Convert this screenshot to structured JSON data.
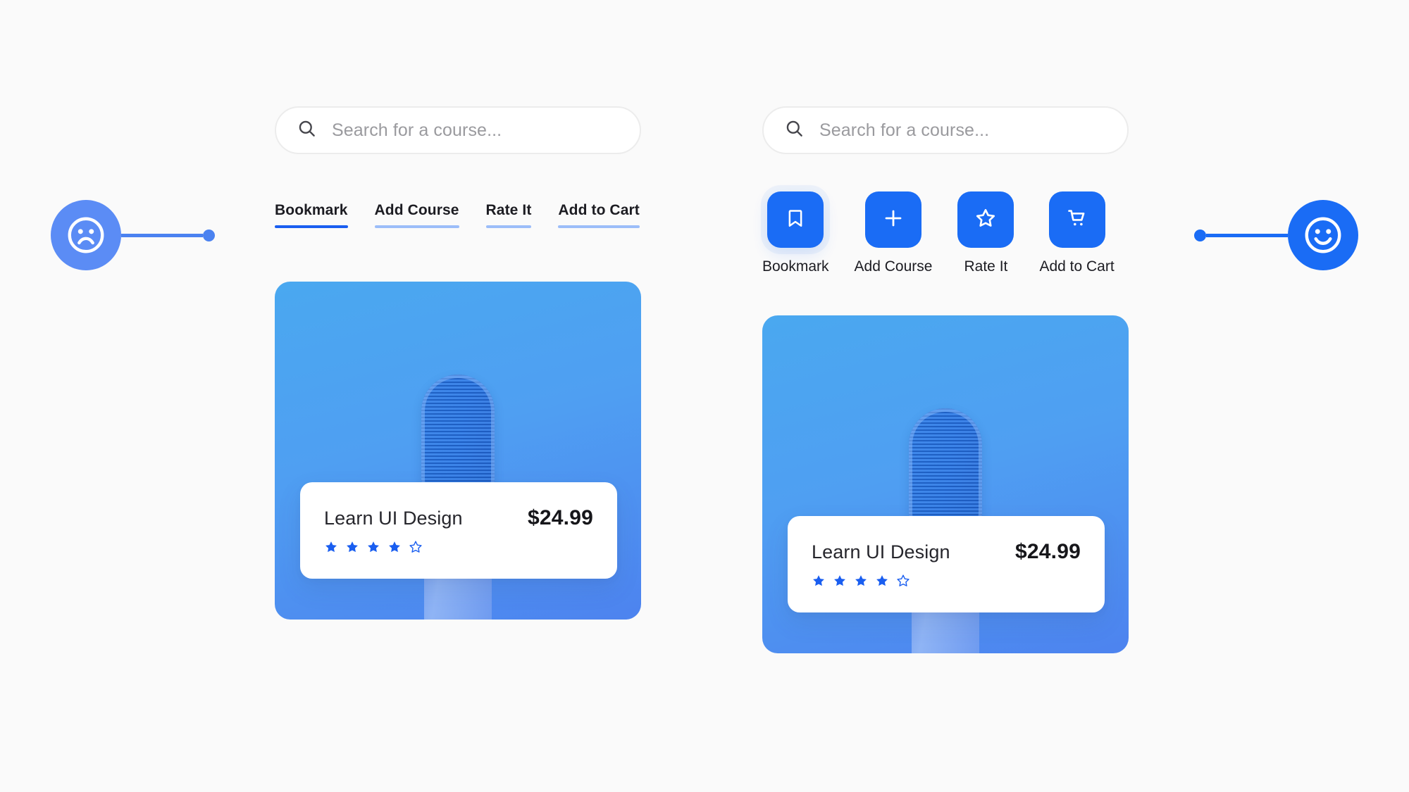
{
  "page": {
    "background_color": "#fafafa",
    "accent_blue": "#1a6cf5",
    "accent_blue_light": "#5b8cf5",
    "underline_inactive": "#9cbdf9",
    "underline_active": "#1a5ef0"
  },
  "markers": {
    "left": {
      "icon": "sad-face-icon",
      "sentiment": "negative",
      "color": "#5b8cf5"
    },
    "right": {
      "icon": "happy-face-icon",
      "sentiment": "positive",
      "color": "#1a6cf5"
    }
  },
  "variant_a": {
    "search": {
      "icon": "search-icon",
      "placeholder": "Search for a course...",
      "value": ""
    },
    "actions": [
      {
        "label": "Bookmark",
        "active": true
      },
      {
        "label": "Add Course",
        "active": false
      },
      {
        "label": "Rate It",
        "active": false
      },
      {
        "label": "Add to Cart",
        "active": false
      }
    ],
    "card": {
      "title": "Learn UI Design",
      "price": "$24.99",
      "rating_filled": 4,
      "rating_total": 5
    }
  },
  "variant_b": {
    "search": {
      "icon": "search-icon",
      "placeholder": "Search for a course...",
      "value": ""
    },
    "actions": [
      {
        "label": "Bookmark",
        "icon": "bookmark-icon",
        "active": true
      },
      {
        "label": "Add Course",
        "icon": "plus-icon",
        "active": false
      },
      {
        "label": "Rate It",
        "icon": "star-outline-icon",
        "active": false
      },
      {
        "label": "Add to Cart",
        "icon": "shopping-cart-icon",
        "active": false
      }
    ],
    "card": {
      "title": "Learn UI Design",
      "price": "$24.99",
      "rating_filled": 4,
      "rating_total": 5
    }
  }
}
